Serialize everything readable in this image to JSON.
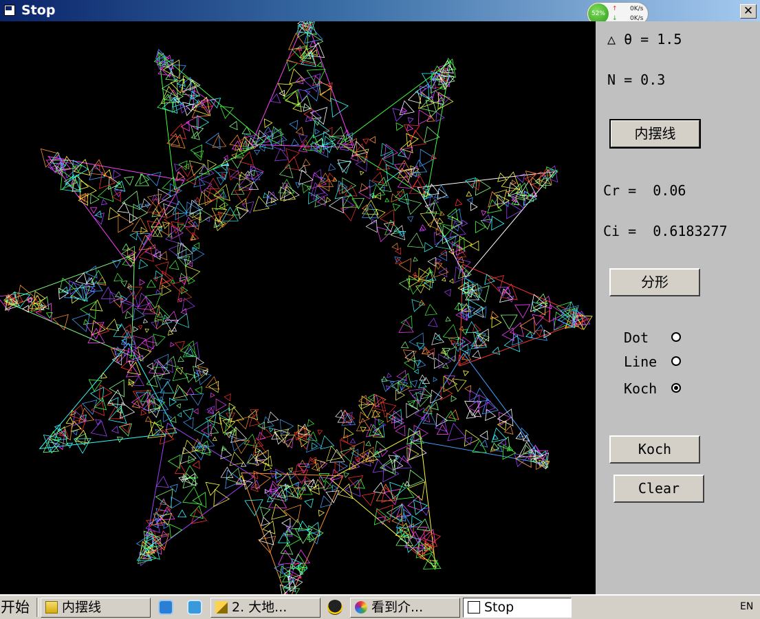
{
  "window": {
    "title": "Stop",
    "close_glyph": "✕"
  },
  "net_widget": {
    "cpu": "52%",
    "up": "0K/s",
    "down": "0K/s"
  },
  "panel": {
    "theta_label": "△ θ = 1.5",
    "n_label": "N = 0.3",
    "hypocycloid_button": "内摆线",
    "cr_label": "Cr =  0.06",
    "ci_label": "Ci =  0.6183277",
    "fractal_button": "分形",
    "radio_options": [
      {
        "label": "Dot",
        "checked": false
      },
      {
        "label": "Line",
        "checked": false
      },
      {
        "label": "Koch",
        "checked": true
      }
    ],
    "koch_button": "Koch",
    "clear_button": "Clear"
  },
  "taskbar": {
    "start_label": "开始",
    "tasks": [
      {
        "label": "内摆线",
        "icon": "folder-icon",
        "active": false
      },
      {
        "label": "2. 大地...",
        "icon": "pencil-icon",
        "active": false
      },
      {
        "label": "看到介...",
        "icon": "colorwheel-icon",
        "active": false
      },
      {
        "label": "Stop",
        "icon": "window-icon",
        "active": true
      }
    ],
    "quick_launch": [
      "browser-icon",
      "ie-icon",
      "qq-icon"
    ],
    "tray_language": "EN"
  },
  "canvas": {
    "background": "#000000",
    "star_points": 12,
    "palette": [
      "#ff40ff",
      "#40ff40",
      "#ffffff",
      "#ff3030",
      "#40a0ff",
      "#ffff40",
      "#ff9030",
      "#a040ff",
      "#30ffff",
      "#80ff80"
    ]
  }
}
